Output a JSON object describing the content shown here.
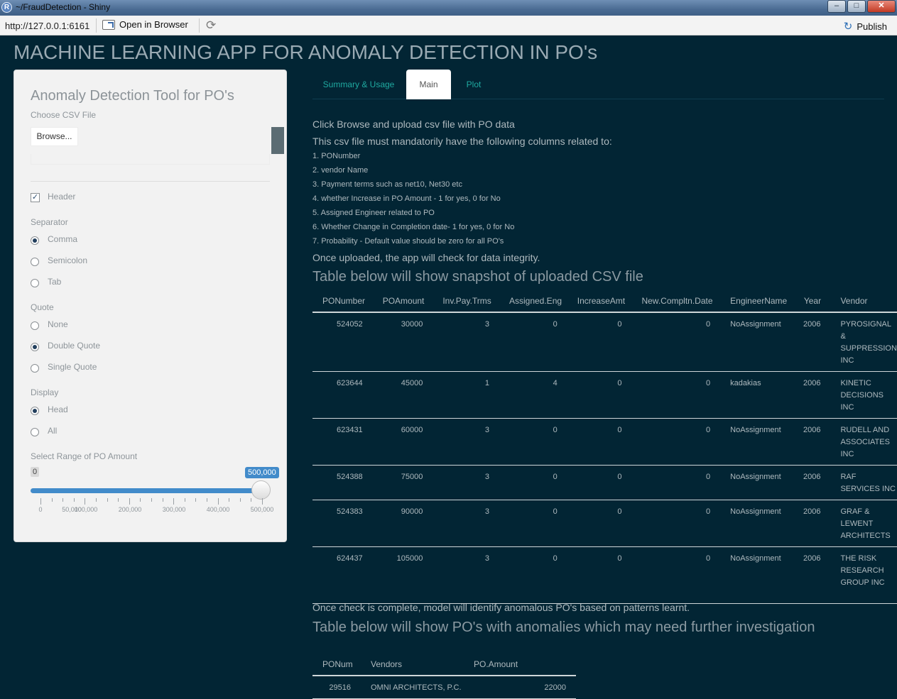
{
  "window": {
    "title": "~/FraudDetection - Shiny",
    "app_icon": "R",
    "controls": {
      "minimize": "–",
      "maximize": "□",
      "close": "✕"
    }
  },
  "toolbar": {
    "url": "http://127.0.0.1:6161",
    "open_in_browser": "Open in Browser",
    "publish": "Publish"
  },
  "app": {
    "title": "MACHINE LEARNING APP FOR ANOMALY DETECTION IN PO's"
  },
  "sidebar": {
    "title": "Anomaly Detection Tool for PO's",
    "file_label": "Choose CSV File",
    "browse": "Browse...",
    "header_label": "Header",
    "separator_label": "Separator",
    "separator_options": [
      "Comma",
      "Semicolon",
      "Tab"
    ],
    "quote_label": "Quote",
    "quote_options": [
      "None",
      "Double Quote",
      "Single Quote"
    ],
    "display_label": "Display",
    "display_options": [
      "Head",
      "All"
    ],
    "range_label": "Select Range of PO Amount",
    "slider": {
      "min_label": "0",
      "max_label": "500,000",
      "selected_from": 0,
      "selected_to": 500000,
      "ticks": [
        "0",
        "50,000",
        "100,000",
        "200,000",
        "300,000",
        "400,000",
        "500,000"
      ]
    }
  },
  "tabs": [
    "Summary & Usage",
    "Main",
    "Plot"
  ],
  "active_tab": "Main",
  "main": {
    "intro1": "Click Browse and upload csv file with PO data",
    "intro2": "This csv file must mandatorily have the following columns related to:",
    "items": [
      "1. PONumber",
      "2. vendor Name",
      "3. Payment terms such as net10, Net30 etc",
      "4. whether Increase in PO Amount - 1 for yes, 0 for No",
      "5. Assigned Engineer related to PO",
      "6. Whether Change in Completion date- 1 for yes, 0 for No",
      "7. Probability - Default value should be zero for all PO's"
    ],
    "intro3": "Once uploaded, the app will check for data integrity.",
    "snapshot_heading": "Table below will show snapshot of uploaded CSV file",
    "snapshot_table": {
      "headers": [
        "PONumber",
        "POAmount",
        "Inv.Pay.Trms",
        "Assigned.Eng",
        "IncreaseAmt",
        "New.Compltn.Date",
        "EngineerName",
        "Year",
        "Vendor"
      ],
      "rows": [
        [
          "524052",
          "30000",
          "3",
          "0",
          "0",
          "0",
          "NoAssignment",
          "2006",
          "PYROSIGNAL & SUPPRESSION INC"
        ],
        [
          "623644",
          "45000",
          "1",
          "4",
          "0",
          "0",
          "kadakias",
          "2006",
          "KINETIC DECISIONS INC"
        ],
        [
          "623431",
          "60000",
          "3",
          "0",
          "0",
          "0",
          "NoAssignment",
          "2006",
          "RUDELL AND ASSOCIATES INC"
        ],
        [
          "524388",
          "75000",
          "3",
          "0",
          "0",
          "0",
          "NoAssignment",
          "2006",
          "RAF SERVICES INC"
        ],
        [
          "524383",
          "90000",
          "3",
          "0",
          "0",
          "0",
          "NoAssignment",
          "2006",
          "GRAF & LEWENT ARCHITECTS"
        ],
        [
          "624437",
          "105000",
          "3",
          "0",
          "0",
          "0",
          "NoAssignment",
          "2006",
          "THE RISK RESEARCH GROUP INC"
        ]
      ]
    },
    "check_text": "Once check is complete, model will identify anomalous PO's based on patterns learnt.",
    "anomaly_heading": "Table below will show PO's with anomalies which may need further investigation",
    "anomaly_table": {
      "headers": [
        "PONum",
        "Vendors",
        "PO.Amount"
      ],
      "rows": [
        [
          "29516",
          "OMNI ARCHITECTS, P.C.",
          "22000"
        ]
      ]
    }
  }
}
